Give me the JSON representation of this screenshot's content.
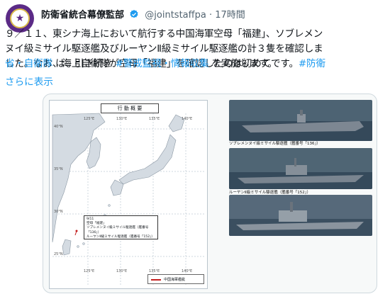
{
  "post": {
    "author_name": "防衛省統合幕僚監部",
    "handle": "@jointstaffpa",
    "separator": "·",
    "time": "17時間",
    "body": {
      "line1": "９／１１、東シナ海上において航行する中国海軍空母「福建」、ソブレメン",
      "line2": "ヌイ級ミサイル駆逐艦及びルーヤンⅡ級ミサイル駆逐艦の計３隻を確認しま",
      "line3_text": "した。なお、海上自衛隊が空母「福建」を確認したのは初めてです。",
      "line3_hashtag": "#防衛",
      "line4_hashtag": "省・自衛隊",
      "line4_mid": " は、引き続き ",
      "line4_hashtag2": "#警戒監視・情報収集",
      "line4_end": " を実施します。"
    },
    "show_more": "さらに表示",
    "colors": {
      "hashtag": "#1d9bf0",
      "verified": "#1d9bf0",
      "avatar": "#5b2a86"
    }
  },
  "media": {
    "map": {
      "title": "行 動 概 要",
      "lon_labels": [
        "125°E",
        "130°E",
        "135°E",
        "140°E"
      ],
      "lat_labels": [
        "40°N",
        "35°N",
        "30°N",
        "25°N"
      ],
      "lon_labels_bottom": [
        "125°E",
        "130°E",
        "135°E",
        "140°E"
      ],
      "annotation": {
        "date": "9/11",
        "line1": "空母「福建」",
        "line2": "ソブレメンヌイ級ミサイル駆逐艦（艦番号「136」）",
        "line3": "ルーヤンⅡ級ミサイル駆逐艦（艦番号「152」）"
      },
      "legend": "中国海軍艦艇"
    },
    "photos": [
      {
        "caption": ""
      },
      {
        "caption": "ソブレメンヌイ級ミサイル駆逐艦（艦番号「136」）"
      },
      {
        "caption": "ルーヤンⅡ級ミサイル駆逐艦（艦番号「152」）"
      }
    ]
  }
}
